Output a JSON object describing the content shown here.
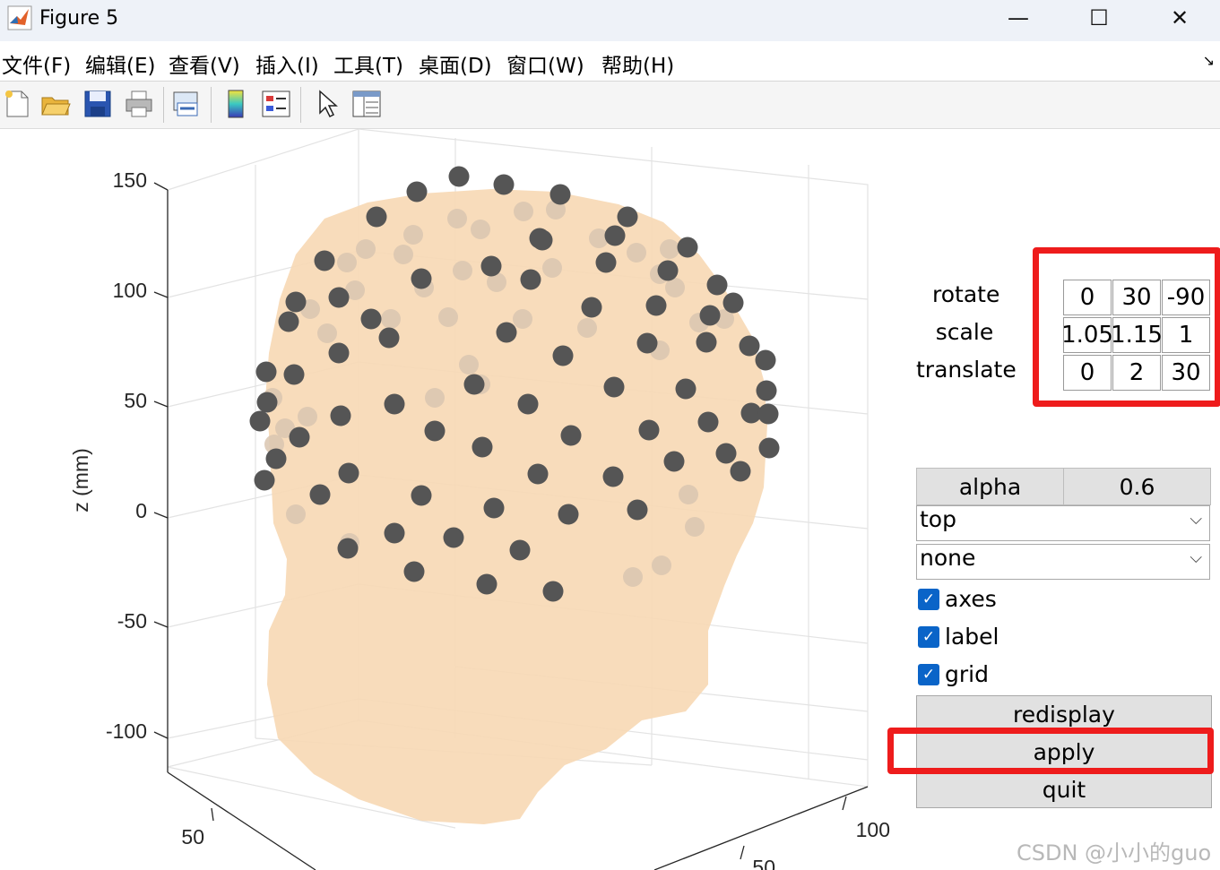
{
  "window": {
    "title": "Figure 5",
    "minimize": "—",
    "maximize": "☐",
    "close": "✕"
  },
  "menu": [
    "文件(F)",
    "编辑(E)",
    "查看(V)",
    "插入(I)",
    "工具(T)",
    "桌面(D)",
    "窗口(W)",
    "帮助(H)"
  ],
  "toolbar": [
    "new-figure-icon",
    "open-folder-icon",
    "save-icon",
    "print-icon",
    "link-icon",
    "colorbar-icon",
    "legend-icon",
    "pointer-icon",
    "property-editor-icon"
  ],
  "axes": {
    "zlabel": "z (mm)",
    "z_ticks": [
      "150",
      "100",
      "50",
      "0",
      "-50",
      "-100"
    ],
    "x_tick": "50",
    "y_ticks": [
      "100",
      "50"
    ]
  },
  "transform": {
    "rows": [
      {
        "label": "rotate",
        "values": [
          "0",
          "30",
          "-90"
        ]
      },
      {
        "label": "scale",
        "values": [
          "1.05",
          "1.15",
          "1"
        ]
      },
      {
        "label": "translate",
        "values": [
          "0",
          "2",
          "30"
        ]
      }
    ]
  },
  "alpha": {
    "label": "alpha",
    "value": "0.6"
  },
  "view_select": {
    "value": "top"
  },
  "style_select": {
    "value": "none"
  },
  "checks": [
    {
      "label": "axes",
      "checked": true
    },
    {
      "label": "label",
      "checked": true
    },
    {
      "label": "grid",
      "checked": true
    }
  ],
  "buttons": {
    "redisplay": "redisplay",
    "apply": "apply",
    "quit": "quit"
  },
  "colors": {
    "head": "#f7d8b4",
    "electrode": "#555555",
    "highlight": "#ee1c1c"
  },
  "watermark": "CSDN @小小的guo"
}
